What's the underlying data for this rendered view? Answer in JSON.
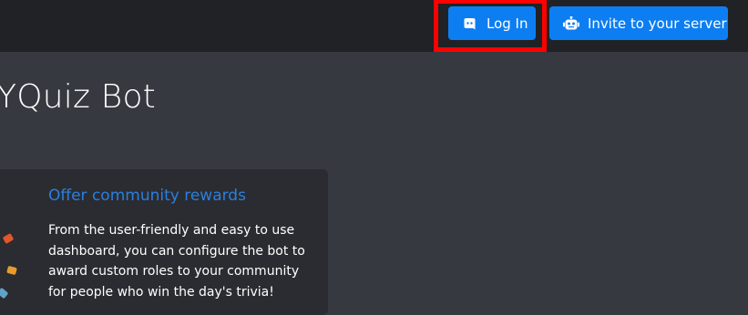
{
  "navbar": {
    "login_label": "Log In",
    "invite_label": "Invite to your server",
    "login_icon": "discord-icon",
    "invite_icon": "robot-icon"
  },
  "hero": {
    "title": "YQuiz Bot"
  },
  "feature_card": {
    "title": "Offer community rewards",
    "text": "From the user-friendly and easy to use dashboard, you can configure the bot to award custom roles to your community for people who win the day's trivia!"
  },
  "colors": {
    "accent": "#0d7ef2",
    "highlight": "#ff0000",
    "background": "#36393f",
    "navbar": "#202225",
    "card": "#2a2c31",
    "card_title": "#2b7fe0"
  }
}
